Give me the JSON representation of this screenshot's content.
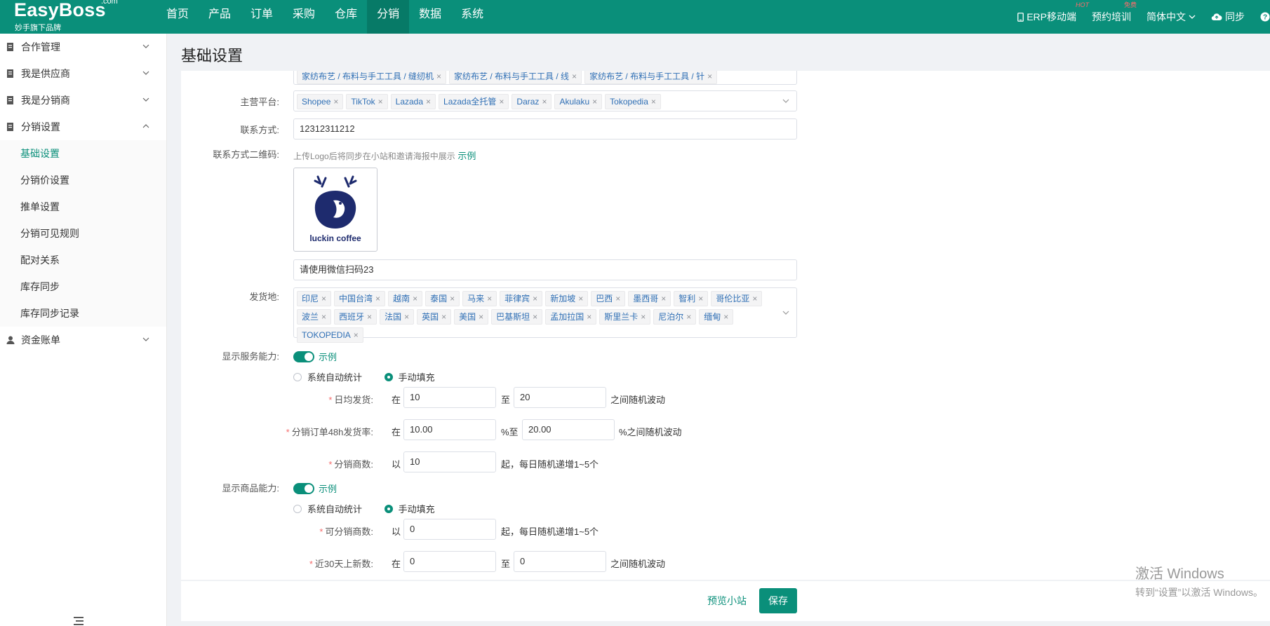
{
  "brand": {
    "name": "EasyBoss",
    "com": ".com",
    "sub": "妙手旗下品牌"
  },
  "nav": [
    {
      "label": "首页"
    },
    {
      "label": "产品"
    },
    {
      "label": "订单"
    },
    {
      "label": "采购"
    },
    {
      "label": "仓库"
    },
    {
      "label": "分销",
      "active": true
    },
    {
      "label": "数据"
    },
    {
      "label": "系统"
    }
  ],
  "topright": {
    "mobile": "ERP移动端",
    "mobile_badge": "HOT",
    "training": "预约培训",
    "training_badge": "免费",
    "lang": "简体中文",
    "sync": "同步"
  },
  "sidebar": {
    "groups": [
      {
        "label": "合作管理"
      },
      {
        "label": "我是供应商"
      },
      {
        "label": "我是分销商"
      },
      {
        "label": "分销设置"
      }
    ],
    "sub_items": [
      {
        "label": "基础设置",
        "active": true
      },
      {
        "label": "分销价设置"
      },
      {
        "label": "推单设置"
      },
      {
        "label": "分销可见规则"
      },
      {
        "label": "配对关系"
      },
      {
        "label": "库存同步"
      },
      {
        "label": "库存同步记录"
      }
    ],
    "last_group": {
      "label": "资金账单"
    }
  },
  "page": {
    "title": "基础设置"
  },
  "form": {
    "category_tags": [
      "家纺布艺 / 布料与手工工具 / 缝纫机",
      "家纺布艺 / 布料与手工工具 / 线",
      "家纺布艺 / 布料与手工工具 / 针"
    ],
    "platform": {
      "label": "主营平台:",
      "tags": [
        "Shopee",
        "TikTok",
        "Lazada",
        "Lazada全托管",
        "Daraz",
        "Akulaku",
        "Tokopedia"
      ]
    },
    "contact": {
      "label": "联系方式:",
      "value": "12312311212"
    },
    "qrcode": {
      "label": "联系方式二维码:",
      "hint": "上传Logo后将同步在小站和邀请海报中展示",
      "example": "示例",
      "logo_text": "luckin coffee",
      "caption": "请使用微信扫码23"
    },
    "ship_from": {
      "label": "发货地:",
      "tags": [
        "印尼",
        "中国台湾",
        "越南",
        "泰国",
        "马来",
        "菲律宾",
        "新加坡",
        "巴西",
        "墨西哥",
        "智利",
        "哥伦比亚",
        "波兰",
        "西班牙",
        "法国",
        "英国",
        "美国",
        "巴基斯坦",
        "孟加拉国",
        "斯里兰卡",
        "尼泊尔",
        "缅甸",
        "TOKOPEDIA"
      ]
    },
    "service": {
      "label": "显示服务能力:",
      "example": "示例",
      "radio_auto": "系统自动统计",
      "radio_manual": "手动填充",
      "daily_ship": {
        "label": "日均发货:",
        "pre": "在",
        "from": "10",
        "mid": "至",
        "to": "20",
        "post": "之间随机波动"
      },
      "rate48": {
        "label": "分销订单48h发货率:",
        "pre": "在",
        "from": "10.00",
        "mid": "%至",
        "to": "20.00",
        "post": "%之间随机波动"
      },
      "distributors": {
        "label": "分销商数:",
        "pre": "以",
        "value": "10",
        "post": "起，每日随机递增1~5个"
      }
    },
    "product": {
      "label": "显示商品能力:",
      "example": "示例",
      "radio_auto": "系统自动统计",
      "radio_manual": "手动填充",
      "dist_count": {
        "label": "可分销商数:",
        "pre": "以",
        "value": "0",
        "post": "起，每日随机递增1~5个"
      },
      "new30": {
        "label": "近30天上新数:",
        "pre": "在",
        "from": "0",
        "mid": "至",
        "to": "0",
        "post": "之间随机波动"
      }
    }
  },
  "footer": {
    "preview": "预览小站",
    "save": "保存"
  },
  "watermark": {
    "line1": "激活 Windows",
    "line2": "转到“设置”以激活 Windows。"
  },
  "colors": {
    "primary": "#0a8f7a",
    "required": "#f56c6c"
  }
}
